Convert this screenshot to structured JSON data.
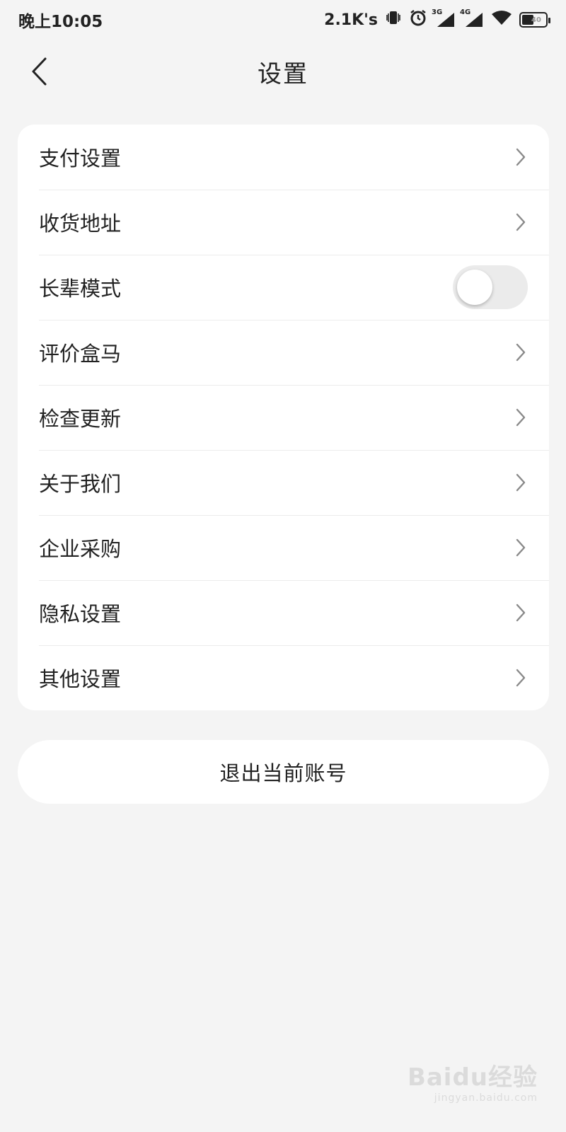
{
  "status_bar": {
    "time": "晚上10:05",
    "net_speed": "2.1K's",
    "sim1_label": "3G",
    "sim2_label": "4G",
    "battery_level": "40"
  },
  "header": {
    "title": "设置",
    "back_icon": "chevron-left-icon"
  },
  "settings": {
    "items": [
      {
        "label": "支付设置",
        "type": "link"
      },
      {
        "label": "收货地址",
        "type": "link"
      },
      {
        "label": "长辈模式",
        "type": "toggle",
        "enabled": false
      },
      {
        "label": "评价盒马",
        "type": "link"
      },
      {
        "label": "检查更新",
        "type": "link"
      },
      {
        "label": "关于我们",
        "type": "link"
      },
      {
        "label": "企业采购",
        "type": "link"
      },
      {
        "label": "隐私设置",
        "type": "link"
      },
      {
        "label": "其他设置",
        "type": "link"
      }
    ]
  },
  "logout": {
    "label": "退出当前账号"
  },
  "watermark": {
    "brand": "Baidu经验",
    "url": "jingyan.baidu.com"
  },
  "colors": {
    "background": "#f4f4f4",
    "card": "#ffffff",
    "text": "#222222",
    "chevron": "#8a8a8a",
    "toggle_off": "#ebebeb"
  }
}
